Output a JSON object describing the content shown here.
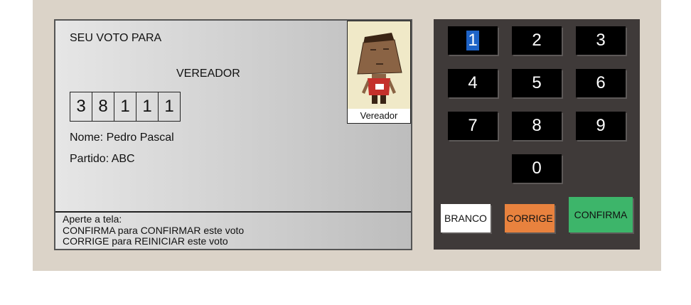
{
  "screen": {
    "heading": "SEU VOTO PARA",
    "role": "VEREADOR",
    "digits": [
      "3",
      "8",
      "1",
      "1",
      "1"
    ],
    "name_line": "Nome: Pedro Pascal",
    "party_line": "Partido: ABC",
    "photo_caption": "Vereador",
    "footer": {
      "line1": "Aperte a tela:",
      "line2": "CONFIRMA para CONFIRMAR este voto",
      "line3": "CORRIGE para REINICIAR este voto"
    }
  },
  "keypad": {
    "keys": [
      "1",
      "2",
      "3",
      "4",
      "5",
      "6",
      "7",
      "8",
      "9",
      "0"
    ],
    "selected_key": "1",
    "branco_label": "BRANCO",
    "corrige_label": "CORRIGE",
    "confirma_label": "CONFIRMA"
  },
  "colors": {
    "background": "#dbd3c8",
    "keypad_panel": "#3f3a39",
    "key_face": "#000000",
    "branco": "#ffffff",
    "corrige": "#e8823e",
    "confirma": "#3db56a",
    "selection": "#1e63c7"
  }
}
